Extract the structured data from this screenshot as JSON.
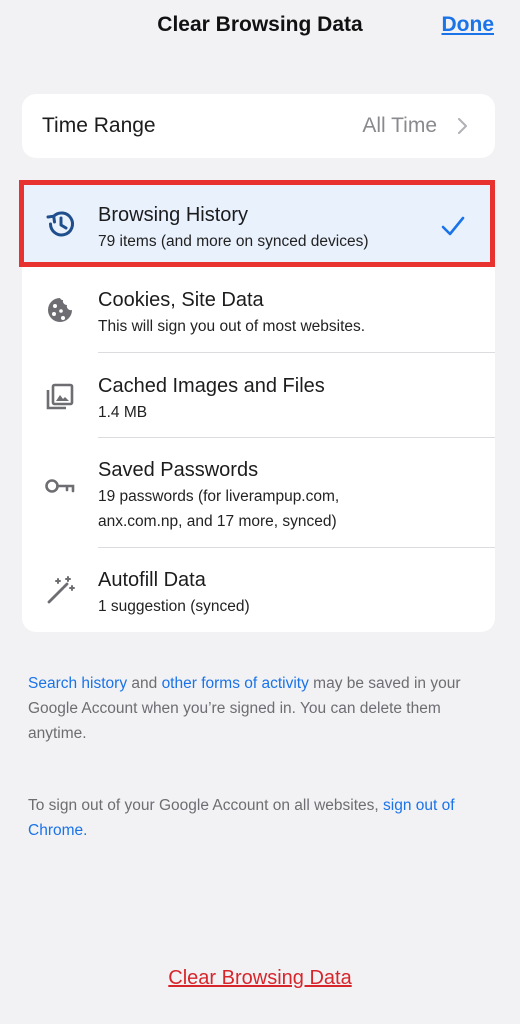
{
  "header": {
    "title": "Clear Browsing Data",
    "done_label": "Done"
  },
  "time_range": {
    "label": "Time Range",
    "value": "All Time"
  },
  "items": [
    {
      "title": "Browsing History",
      "subtitle": "79 items (and more on synced devices)",
      "icon": "history-icon",
      "checked": true
    },
    {
      "title": "Cookies, Site Data",
      "subtitle": "This will sign you out of most websites.",
      "icon": "cookie-icon",
      "checked": false
    },
    {
      "title": "Cached Images and Files",
      "subtitle": "1.4 MB",
      "icon": "image-icon",
      "checked": false
    },
    {
      "title": "Saved Passwords",
      "subtitle_line1": "19 passwords (for liverampup.com,",
      "subtitle_line2": "anx.com.np, and 17 more, synced)",
      "icon": "key-icon",
      "checked": false
    },
    {
      "title": "Autofill Data",
      "subtitle": "1 suggestion (synced)",
      "icon": "magic-wand-icon",
      "checked": false
    }
  ],
  "info": {
    "link1": "Search history",
    "text1": " and ",
    "link2": "other forms of activity",
    "text2": " may be saved in your Google Account when you’re signed in. You can delete them anytime."
  },
  "signout": {
    "text": "To sign out of your Google Account on all websites, ",
    "link": "sign out of Chrome",
    "end": "."
  },
  "footer": {
    "clear_label": "Clear Browsing Data"
  },
  "colors": {
    "accent": "#1a73e8",
    "destructive": "#d7262b",
    "highlight": "#e8322f"
  }
}
